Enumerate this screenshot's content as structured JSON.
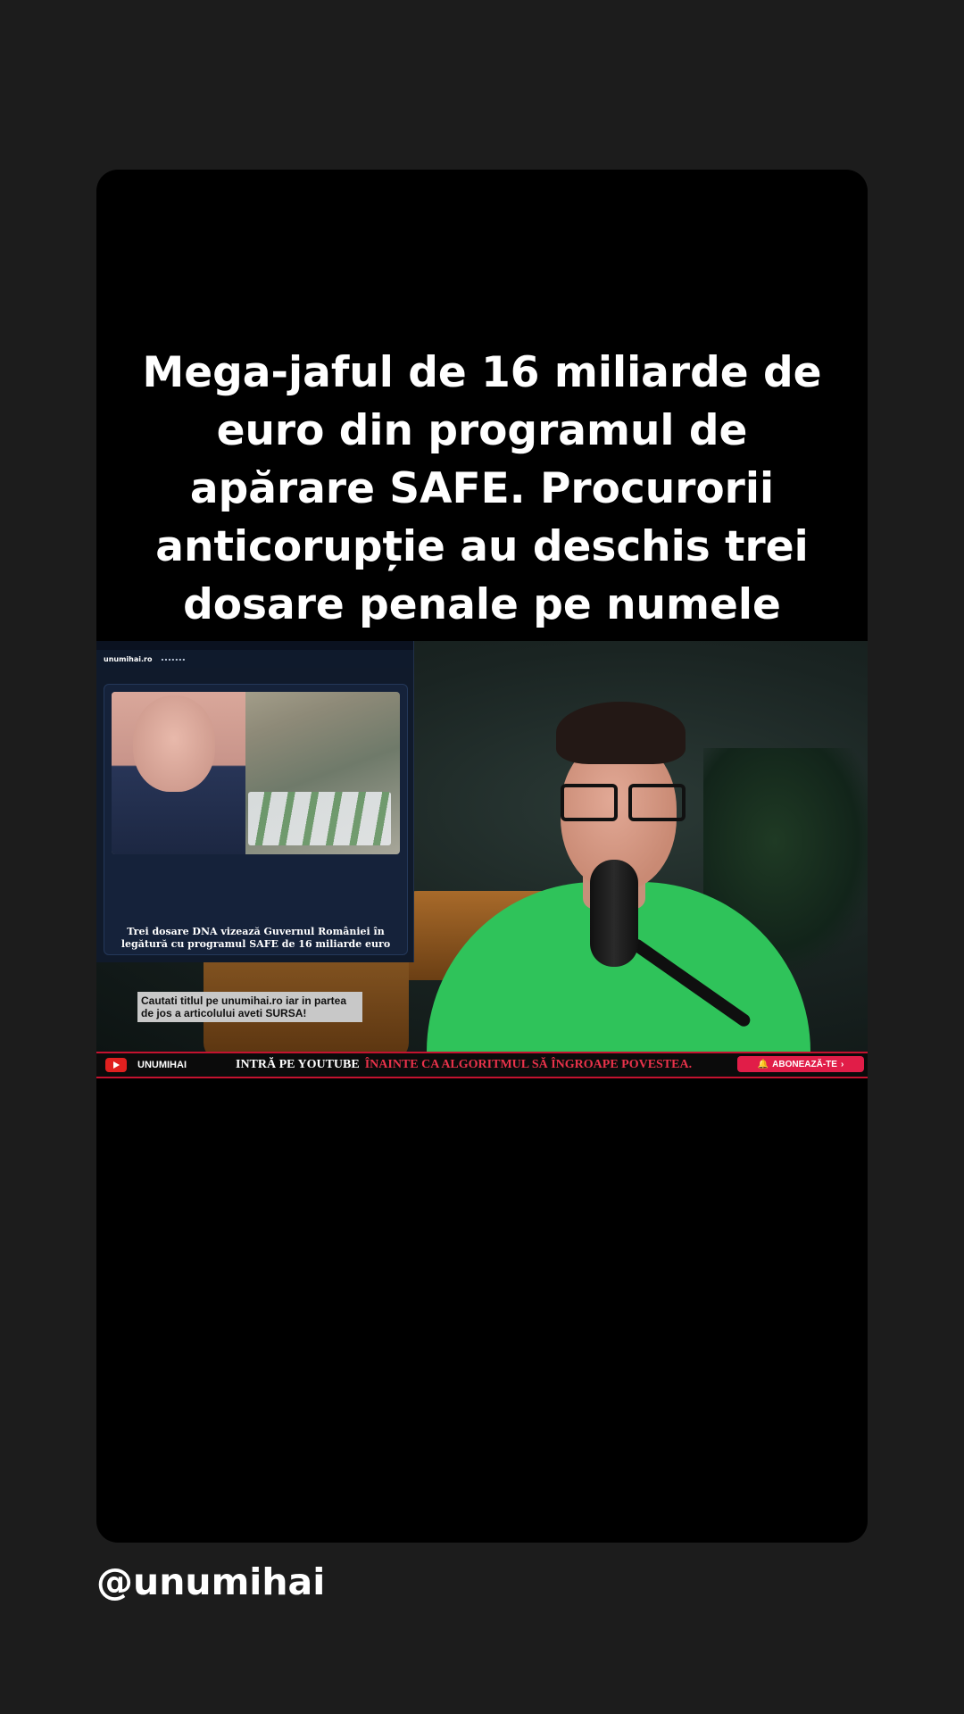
{
  "headline": "Mega-jaful de 16 miliarde de euro din programul de apărare SAFE. Procurorii anticorupție au deschis trei dosare penale pe numele Guvernului!",
  "article": {
    "site_logo": "unumihai.ro",
    "title": "Trei dosare DNA vizează Guvernul României în legătură cu programul SAFE de 16 miliarde euro"
  },
  "source_caption": {
    "line1": "Cautati titlul pe unumihai.ro iar in partea",
    "line2": "de jos a articolului aveti SURSA!"
  },
  "banner": {
    "channel": "UNUMIHAI",
    "cta": "INTRĂ PE YOUTUBE",
    "warning": "ÎNAINTE CA ALGORITMUL SĂ ÎNGROAPE POVESTEA.",
    "subscribe": "ABONEAZĂ-TE",
    "accent_color": "#c4122f"
  },
  "username": "@unumihai"
}
